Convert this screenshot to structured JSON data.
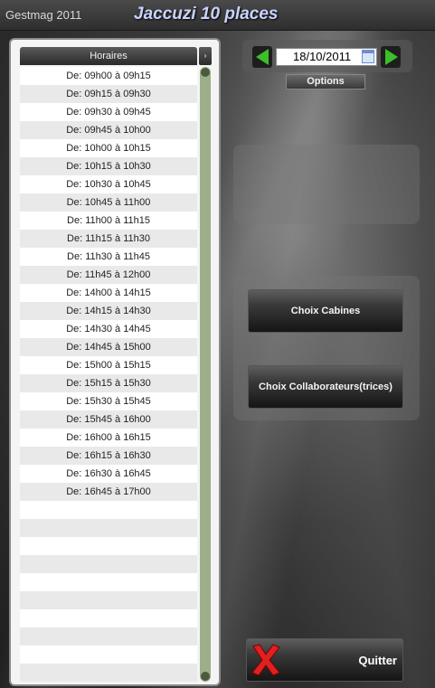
{
  "window": {
    "app_name": "Gestmag 2011",
    "page_title": "Jaccuzi 10 places"
  },
  "schedule": {
    "header": "Horaires",
    "scroll_button": "›",
    "slots": [
      "De: 09h00 à 09h15",
      "De: 09h15 à 09h30",
      "De: 09h30 à 09h45",
      "De: 09h45 à 10h00",
      "De: 10h00 à 10h15",
      "De: 10h15 à 10h30",
      "De: 10h30 à 10h45",
      "De: 10h45 à 11h00",
      "De: 11h00 à 11h15",
      "De: 11h15 à 11h30",
      "De: 11h30 à 11h45",
      "De: 11h45 à 12h00",
      "De: 14h00 à 14h15",
      "De: 14h15 à 14h30",
      "De: 14h30 à 14h45",
      "De: 14h45 à 15h00",
      "De: 15h00 à 15h15",
      "De: 15h15 à 15h30",
      "De: 15h30 à 15h45",
      "De: 15h45 à 16h00",
      "De: 16h00 à 16h15",
      "De: 16h15 à 16h30",
      "De: 16h30 à 16h45",
      "De: 16h45 à 17h00"
    ]
  },
  "date_picker": {
    "value": "18/10/2011",
    "options_label": "Options",
    "prev_icon": "green-left-arrow-icon",
    "next_icon": "green-right-arrow-icon",
    "calendar_icon": "calendar-icon"
  },
  "actions": {
    "cabines_label": "Choix Cabines",
    "collaborateurs_label": "Choix Collaborateurs(trices)",
    "quit_label": "Quitter",
    "quit_icon": "red-x-icon"
  },
  "colors": {
    "accent_green": "#3bbf2a",
    "scrollbar_green": "#9daf89",
    "quit_red": "#e02020",
    "title_text": "#c9d3ff"
  }
}
